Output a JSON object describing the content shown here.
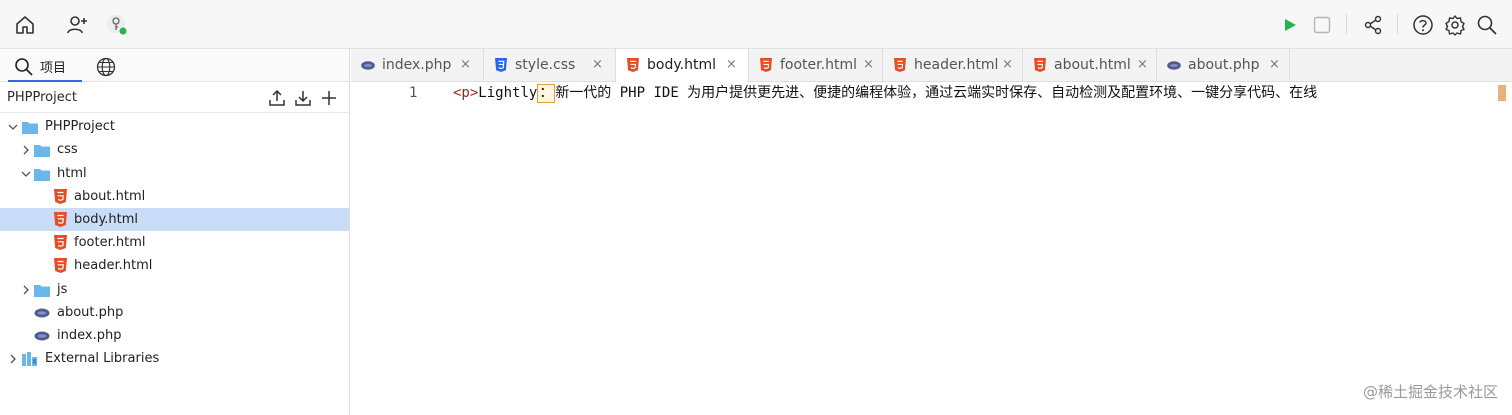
{
  "toolbar": {
    "left_icons": [
      "home-icon",
      "add-user-icon",
      "deploy-key-icon"
    ],
    "right_icons": [
      "run-icon",
      "stop-icon",
      "share-icon",
      "help-icon",
      "settings-icon",
      "search-icon"
    ],
    "colors": {
      "run": "#2bb24c",
      "status_dot": "#2bb24c"
    }
  },
  "sidebar": {
    "tabs": [
      {
        "label": "项目",
        "icon": "search-icon",
        "active": true
      },
      {
        "label": "",
        "icon": "globe-icon",
        "active": false
      }
    ],
    "project_header": {
      "title": "PHPProject",
      "actions": [
        "upload-icon",
        "download-icon",
        "add-icon"
      ]
    },
    "tree": [
      {
        "label": "PHPProject",
        "type": "folder",
        "expanded": true,
        "depth": 0
      },
      {
        "label": "css",
        "type": "folder",
        "expanded": false,
        "depth": 1
      },
      {
        "label": "html",
        "type": "folder",
        "expanded": true,
        "depth": 1
      },
      {
        "label": "about.html",
        "type": "html",
        "depth": 2
      },
      {
        "label": "body.html",
        "type": "html",
        "depth": 2,
        "selected": true
      },
      {
        "label": "footer.html",
        "type": "html",
        "depth": 2
      },
      {
        "label": "header.html",
        "type": "html",
        "depth": 2
      },
      {
        "label": "js",
        "type": "folder",
        "expanded": false,
        "depth": 1
      },
      {
        "label": "about.php",
        "type": "php",
        "depth": 1
      },
      {
        "label": "index.php",
        "type": "php",
        "depth": 1
      },
      {
        "label": "External Libraries",
        "type": "library",
        "expanded": false,
        "depth": 0
      }
    ]
  },
  "editor": {
    "tabs": [
      {
        "label": "index.php",
        "type": "php",
        "close": "×"
      },
      {
        "label": "style.css",
        "type": "css",
        "close": "×"
      },
      {
        "label": "body.html",
        "type": "html",
        "close": "×",
        "active": true
      },
      {
        "label": "footer.html",
        "type": "html",
        "close": "×"
      },
      {
        "label": "header.html",
        "type": "html",
        "close": "×"
      },
      {
        "label": "about.html",
        "type": "html",
        "close": "×"
      },
      {
        "label": "about.php",
        "type": "php",
        "close": "×"
      }
    ],
    "lines": [
      {
        "number": "1",
        "tag": "<p>",
        "before_cursor": "Lightly",
        "cursor_char": "：",
        "after_cursor": "新一代的 PHP IDE 为用户提供更先进、便捷的编程体验，通过云端实时保存、自动检测及配置环境、一键分享代码、在线"
      }
    ]
  },
  "watermark": "@稀土掘金技术社区",
  "colors": {
    "html_icon": "#e44d26",
    "css_icon": "#2965f1",
    "php_icon": "#4f5b93",
    "folder": "#6bb7e8",
    "selected_row": "#c9dcf8",
    "tab_underline": "#2d6cdf"
  }
}
